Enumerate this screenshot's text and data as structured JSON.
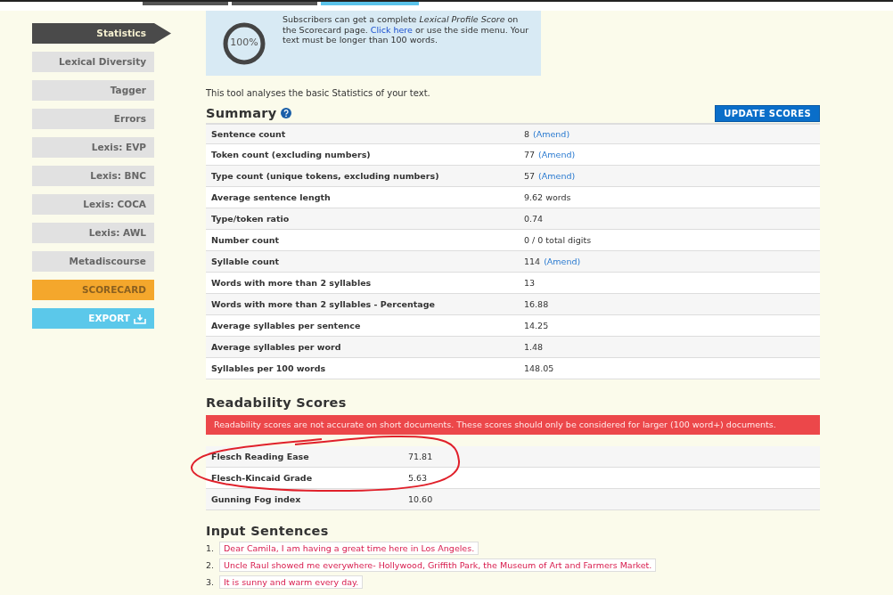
{
  "top_tabs": [
    {
      "selected": false
    },
    {
      "selected": false
    },
    {
      "selected": true
    }
  ],
  "sidebar": {
    "items": [
      {
        "label": "Statistics",
        "kind": "nav",
        "selected": true
      },
      {
        "label": "Lexical Diversity",
        "kind": "nav",
        "selected": false
      },
      {
        "label": "Tagger",
        "kind": "nav",
        "selected": false
      },
      {
        "label": "Errors",
        "kind": "nav",
        "selected": false
      },
      {
        "label": "Lexis: EVP",
        "kind": "nav",
        "selected": false
      },
      {
        "label": "Lexis: BNC",
        "kind": "nav",
        "selected": false
      },
      {
        "label": "Lexis: COCA",
        "kind": "nav",
        "selected": false
      },
      {
        "label": "Lexis: AWL",
        "kind": "nav",
        "selected": false
      },
      {
        "label": "Metadiscourse",
        "kind": "nav",
        "selected": false
      },
      {
        "label": "SCORECARD",
        "kind": "scorecard",
        "selected": false
      },
      {
        "label": "EXPORT",
        "kind": "export",
        "selected": false
      }
    ]
  },
  "info_box": {
    "progress": {
      "label": "100%"
    },
    "text_before": "Subscribers can get a complete *Lexical Profile Score* on the Scorecard page.",
    "link": "Click here",
    "text_after": "or use the side menu. Your text must be longer than 100 words."
  },
  "intro": "This tool analyses the basic Statistics of your text.",
  "summary": {
    "title": "Summary",
    "button": "UPDATE SCORES",
    "rows": [
      {
        "label": "Sentence count",
        "value": "8",
        "action": "(Amend)"
      },
      {
        "label": "Token count (excluding numbers)",
        "value": "77",
        "action": "(Amend)"
      },
      {
        "label": "Type count (unique tokens, excluding numbers)",
        "value": "57",
        "action": "(Amend)"
      },
      {
        "label": "Average sentence length",
        "value": "9.62 words"
      },
      {
        "label": "Type/token ratio",
        "value": "0.74"
      },
      {
        "label": "Number count",
        "value": "0 / 0 total digits"
      },
      {
        "label": "Syllable count",
        "value": "114",
        "action": "(Amend)"
      },
      {
        "label": "Words with more than 2 syllables",
        "value": "13"
      },
      {
        "label": "Words with more than 2 syllables - Percentage",
        "value": "16.88"
      },
      {
        "label": "Average syllables per sentence",
        "value": "14.25"
      },
      {
        "label": "Average syllables per word",
        "value": "1.48"
      },
      {
        "label": "Syllables per 100 words",
        "value": "148.05"
      }
    ]
  },
  "readability": {
    "title": "Readability Scores",
    "warning": "Readability scores are not accurate on short documents. These scores should only be considered for larger (100 word+) documents.",
    "rows": [
      {
        "label": "Flesch Reading Ease",
        "value": "71.81",
        "circled": true
      },
      {
        "label": "Flesch-Kincaid Grade",
        "value": "5.63",
        "circled": true
      },
      {
        "label": "Gunning Fog index",
        "value": "10.60"
      }
    ]
  },
  "input_sentences": {
    "title": "Input Sentences",
    "items": [
      {
        "number": "1.",
        "text": "Dear Camila, I am having a great time here in Los Angeles."
      },
      {
        "number": "2.",
        "text": "Uncle Raul showed me everywhere- Hollywood, Griffith Park, the Museum of Art and Farmers Market."
      },
      {
        "number": "3.",
        "text": "It is sunny and warm every day."
      }
    ]
  }
}
